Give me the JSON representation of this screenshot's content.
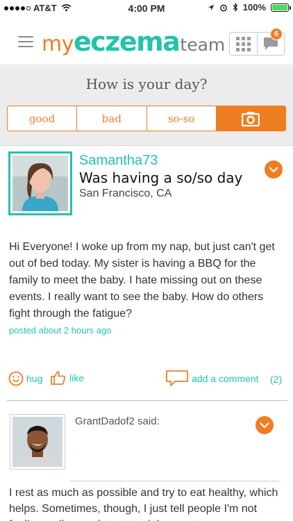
{
  "status_bar": {
    "carrier": "AT&T",
    "time": "4:00 PM",
    "battery": "100%"
  },
  "header": {
    "logo": {
      "prefix": "my",
      "brand": "eczema",
      "suffix": "team"
    },
    "notification_count": "6"
  },
  "day_check": {
    "question": "How is your day?",
    "options": [
      "good",
      "bad",
      "so-so"
    ]
  },
  "post": {
    "username": "Samantha73",
    "mood_text": "Was having a so/so day",
    "location": "San Francisco, CA",
    "body": "Hi Everyone! I woke up from my nap, but just can't get out of bed today. My sister is having a BBQ for the family to meet the baby. I hate missing out on these events. I really want to see the baby. How do others fight through the fatigue?",
    "posted": "posted about 2 hours ago",
    "actions": {
      "hug": "hug",
      "like": "like",
      "comment": "add a comment",
      "comment_count": "(2)"
    }
  },
  "reply": {
    "author_said": "GrantDadof2 said:",
    "body": "I rest as much as possible and try to eat healthy, which helps. Sometimes, though, I just tell people I'm not feeling well enough to attend the event."
  },
  "colors": {
    "accent_orange": "#ef7d22",
    "accent_teal": "#23c3ac"
  }
}
